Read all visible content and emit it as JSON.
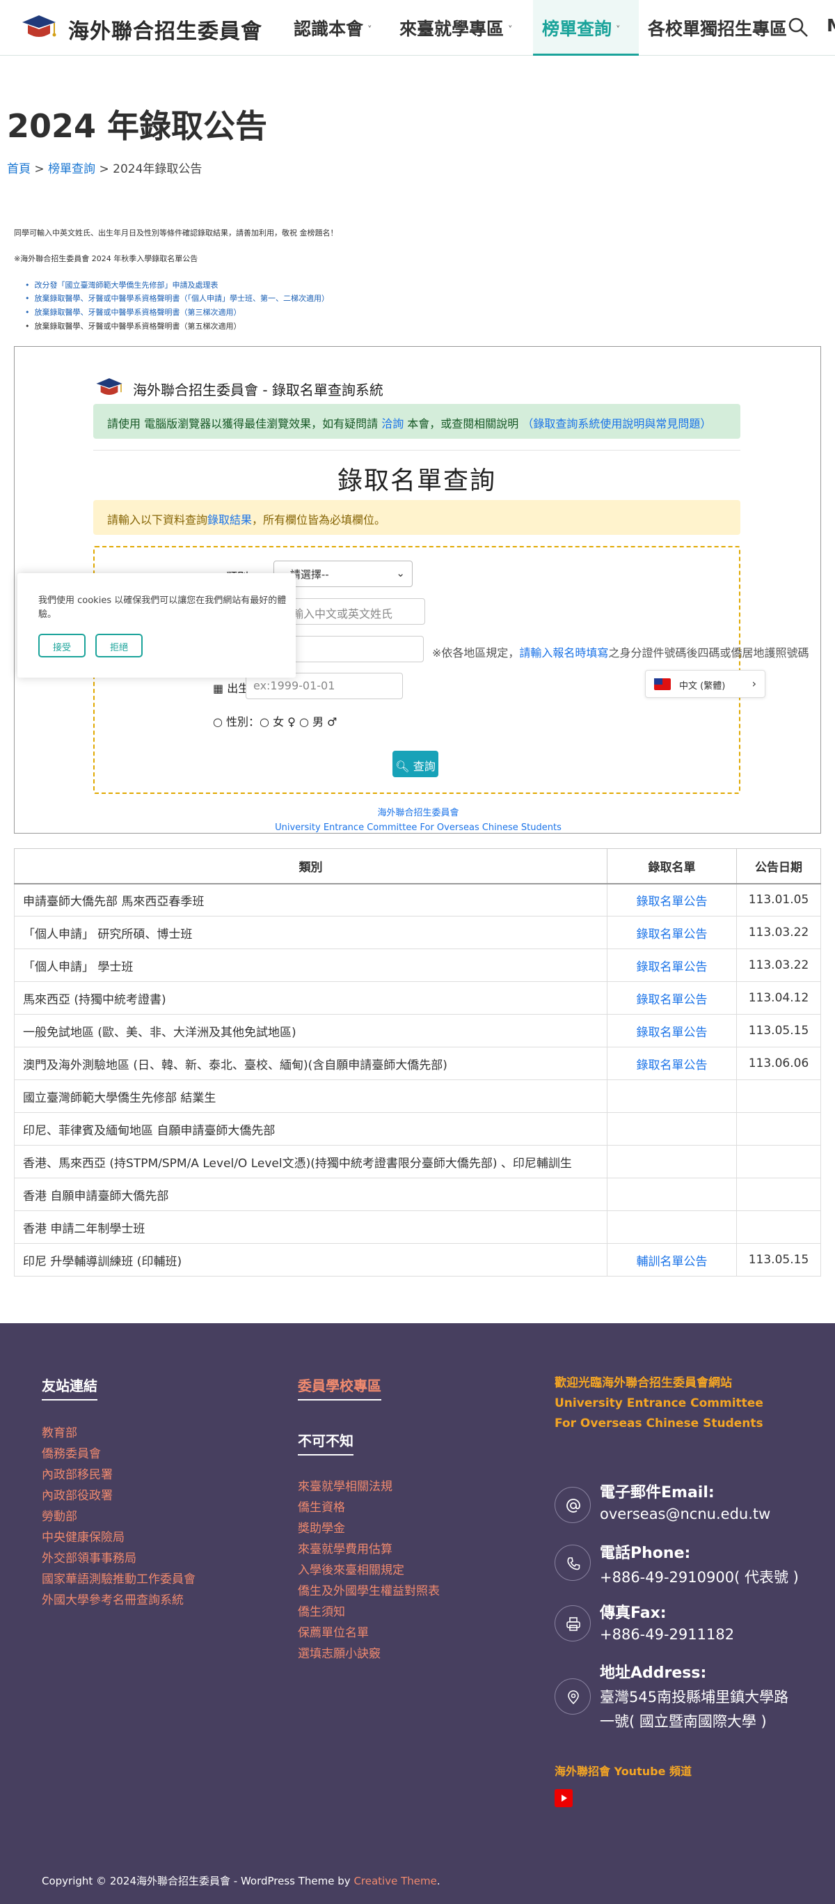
{
  "header": {
    "site_title": "海外聯合招生委員會",
    "nav": [
      {
        "label": "認識本會"
      },
      {
        "label": "來臺就學專區"
      },
      {
        "label": "榜單查詢"
      },
      {
        "label": "各校單獨招生專區"
      },
      {
        "label": "M"
      }
    ]
  },
  "page": {
    "title": "2024 年錄取公告",
    "breadcrumb": {
      "home": "首頁",
      "sep1": " > ",
      "section": "榜單查詢",
      "sep2": " > ",
      "current": "2024年錄取公告"
    },
    "intro": "同學可輸入中英文姓氏、出生年月日及性別等條件確認錄取結果，請善加利用，敬祝 金榜題名！",
    "notice": "※海外聯合招生委員會 2024 年秋季入學錄取名單公告",
    "links": [
      "改分發「國立臺灣師範大學僑生先修部」申請及處理表",
      "放棄錄取醫學、牙醫或中醫學系資格聲明書（「個人申請」學士班、第一、二梯次適用）",
      "放棄錄取醫學、牙醫或中醫學系資格聲明書（第三梯次適用）",
      "放棄錄取醫學、牙醫或中醫學系資格聲明書（第五梯次適用）"
    ]
  },
  "query": {
    "header": "海外聯合招生委員會 - 錄取名單查詢系統",
    "alert_a": "請使用 電腦版瀏覽器以獲得最佳瀏覽效果，如有疑問請 ",
    "alert_link1": "洽詢",
    "alert_b": " 本會，或查閱相關說明 ",
    "alert_link2": "（錄取查詢系統使用說明與常見問題）",
    "title": "錄取名單查詢",
    "warn_a": "請輸入以下資料查詢",
    "warn_link": "錄取結果",
    "warn_b": "，所有欄位皆為必填欄位。",
    "label_type": "● 類別：",
    "select_value": "--請選擇--",
    "placeholder_name": "請輸入中文或英文姓氏",
    "label_id": "",
    "note_a": "※依各地區規定，",
    "note_link": "請輸入報名時填寫",
    "note_b": "之身分證件號碼後四碼或僑居地護照號碼",
    "label_birth": "出生日期",
    "placeholder_birth": "ex:1999-01-01",
    "label_gender": "○ 性別：○ 女 ♀ ○ 男 ♂",
    "button": "查詢",
    "foot1": "海外聯合招生委員會",
    "foot2": "University Entrance Committee For Overseas Chinese Students"
  },
  "cookie": {
    "text": "我們使用 cookies 以確保我們可以讓您在我們網站有最好的體驗。",
    "accept": "接受",
    "reject": "拒絕"
  },
  "language": {
    "label": "中文 (繁體)",
    "chevron": "›"
  },
  "table": {
    "headers": [
      "類別",
      "錄取名單",
      "公告日期"
    ],
    "rows": [
      {
        "cat": "申請臺師大僑先部 馬來西亞春季班",
        "link": "錄取名單公告",
        "date": "113.01.05"
      },
      {
        "cat": "「個人申請」 研究所碩、博士班",
        "link": "錄取名單公告",
        "date": "113.03.22"
      },
      {
        "cat": "「個人申請」 學士班",
        "link": "錄取名單公告",
        "date": "113.03.22"
      },
      {
        "cat": "馬來西亞 (持獨中統考證書)",
        "link": "錄取名單公告",
        "date": "113.04.12"
      },
      {
        "cat": "一般免試地區 (歐、美、非、大洋洲及其他免試地區)",
        "link": "錄取名單公告",
        "date": "113.05.15"
      },
      {
        "cat": "澳門及海外測驗地區 (日、韓、新、泰北、臺校、緬甸)(含自願申請臺師大僑先部)",
        "link": "錄取名單公告",
        "date": "113.06.06"
      },
      {
        "cat": "國立臺灣師範大學僑生先修部 結業生",
        "link": "",
        "date": ""
      },
      {
        "cat": "印尼、菲律賓及緬甸地區 自願申請臺師大僑先部",
        "link": "",
        "date": ""
      },
      {
        "cat": "香港、馬來西亞 (持STPM/SPM/A Level/O Level文憑)(持獨中統考證書限分臺師大僑先部) 、印尼輔訓生",
        "link": "",
        "date": ""
      },
      {
        "cat": "香港 自願申請臺師大僑先部",
        "link": "",
        "date": ""
      },
      {
        "cat": "香港 申請二年制學士班",
        "link": "",
        "date": ""
      },
      {
        "cat": "印尼 升學輔導訓練班 (印輔班)",
        "link": "輔訓名單公告",
        "date": "113.05.15"
      }
    ]
  },
  "footer": {
    "col1_title": "友站連結",
    "col1_links": [
      "教育部",
      "僑務委員會",
      "內政部移民署",
      "內政部役政署",
      "勞動部",
      "中央健康保險局",
      "外交部領事事務局",
      "國家華語測驗推動工作委員會",
      "外國大學參考名冊查詢系統"
    ],
    "col2_title": "委員學校專區",
    "col2b_title": "不可不知",
    "col2_links": [
      "來臺就學相關法規",
      "僑生資格",
      "獎助學金",
      "來臺就學費用估算",
      "入學後來臺相關規定",
      "僑生及外國學生權益對照表",
      "僑生須知",
      "保薦單位名單",
      "選填志願小訣竅"
    ],
    "welcome": "歡迎光臨海外聯合招生委員會網站 University Entrance Committee For Overseas Chinese Students",
    "email_title": "電子郵件Email:",
    "email": "overseas@ncnu.edu.tw",
    "phone_title": "電話Phone:",
    "phone": "+886-49-2910900( 代表號 )",
    "fax_title": "傳真Fax:",
    "fax": "+886-49-2911182",
    "addr_title": "地址Address:",
    "addr1": "臺灣545南投縣埔里鎮大學路",
    "addr2": "一號( 國立暨南國際大學 )",
    "youtube": "海外聯招會 Youtube 頻道",
    "copyright": "Copyright © 2024海外聯合招生委員會 - WordPress Theme by ",
    "theme": "Creative Theme",
    "period": "."
  },
  "colors": {
    "accent": "#1aa39a",
    "footer_bg": "#473f5f",
    "link_orange": "#f08a6e",
    "gold": "#f5a623"
  }
}
